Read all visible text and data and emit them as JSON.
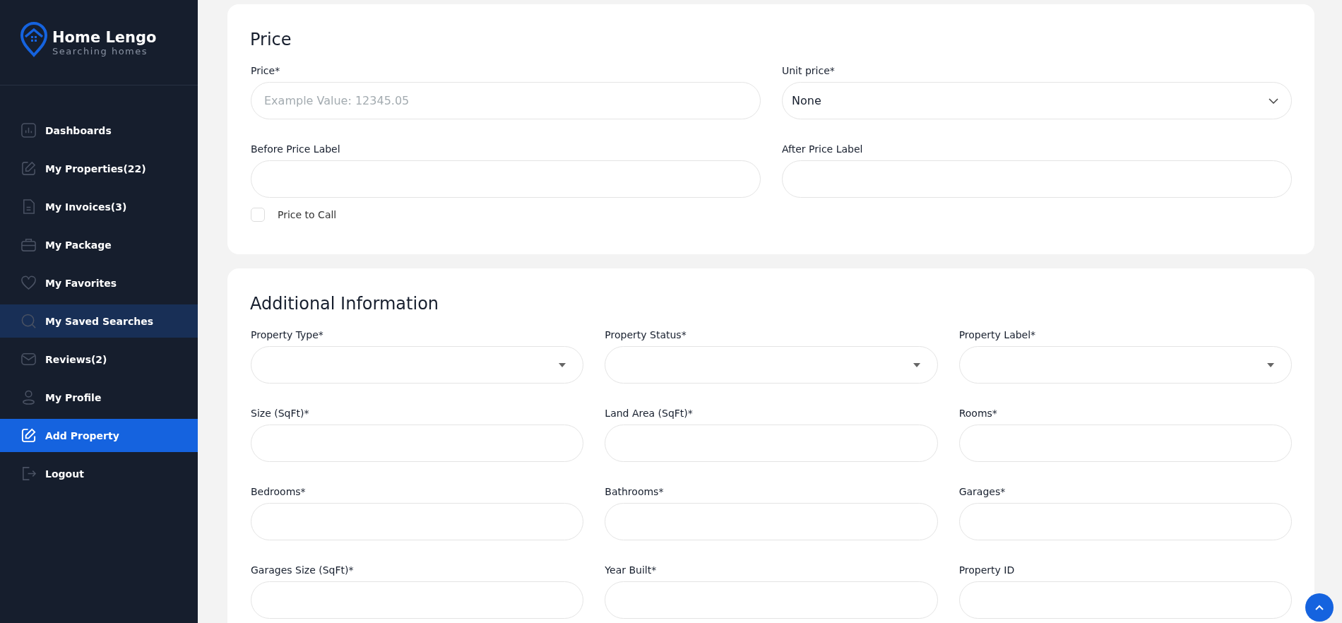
{
  "brand": {
    "name": "Home Lengo",
    "tagline": "Searching homes"
  },
  "sidebar": {
    "items": [
      {
        "label": "Dashboards",
        "selected": false,
        "hovered": false
      },
      {
        "label": "My Properties(22)",
        "selected": false,
        "hovered": false
      },
      {
        "label": "My Invoices(3)",
        "selected": false,
        "hovered": false
      },
      {
        "label": "My Package",
        "selected": false,
        "hovered": false
      },
      {
        "label": "My Favorites",
        "selected": false,
        "hovered": false
      },
      {
        "label": "My Saved Searches",
        "selected": false,
        "hovered": true
      },
      {
        "label": "Reviews(2)",
        "selected": false,
        "hovered": false
      },
      {
        "label": "My Profile",
        "selected": false,
        "hovered": false
      },
      {
        "label": "Add Property",
        "selected": true,
        "hovered": false
      },
      {
        "label": "Logout",
        "selected": false,
        "hovered": false
      }
    ]
  },
  "price_section": {
    "title": "Price",
    "fields": [
      {
        "label": "Price*",
        "kind": "text",
        "placeholder": "Example Value: 12345.05"
      },
      {
        "label": "Unit price*",
        "kind": "dropdown",
        "value": "None"
      },
      {
        "label": "Before Price Label",
        "kind": "text"
      },
      {
        "label": "After Price Label",
        "kind": "text"
      }
    ],
    "checkbox": {
      "label": "Price to Call",
      "checked": false
    }
  },
  "additional_section": {
    "title": "Additional Information",
    "fields": [
      {
        "label": "Property Type*",
        "kind": "select"
      },
      {
        "label": "Property Status*",
        "kind": "select"
      },
      {
        "label": "Property Label*",
        "kind": "select"
      },
      {
        "label": "Size (SqFt)*",
        "kind": "text"
      },
      {
        "label": "Land Area (SqFt)*",
        "kind": "text"
      },
      {
        "label": "Rooms*",
        "kind": "text"
      },
      {
        "label": "Bedrooms*",
        "kind": "text"
      },
      {
        "label": "Bathrooms*",
        "kind": "text"
      },
      {
        "label": "Garages*",
        "kind": "text"
      },
      {
        "label": "Garages Size (SqFt)*",
        "kind": "text"
      },
      {
        "label": "Year Built*",
        "kind": "text"
      },
      {
        "label": "Property ID",
        "kind": "text"
      }
    ]
  }
}
